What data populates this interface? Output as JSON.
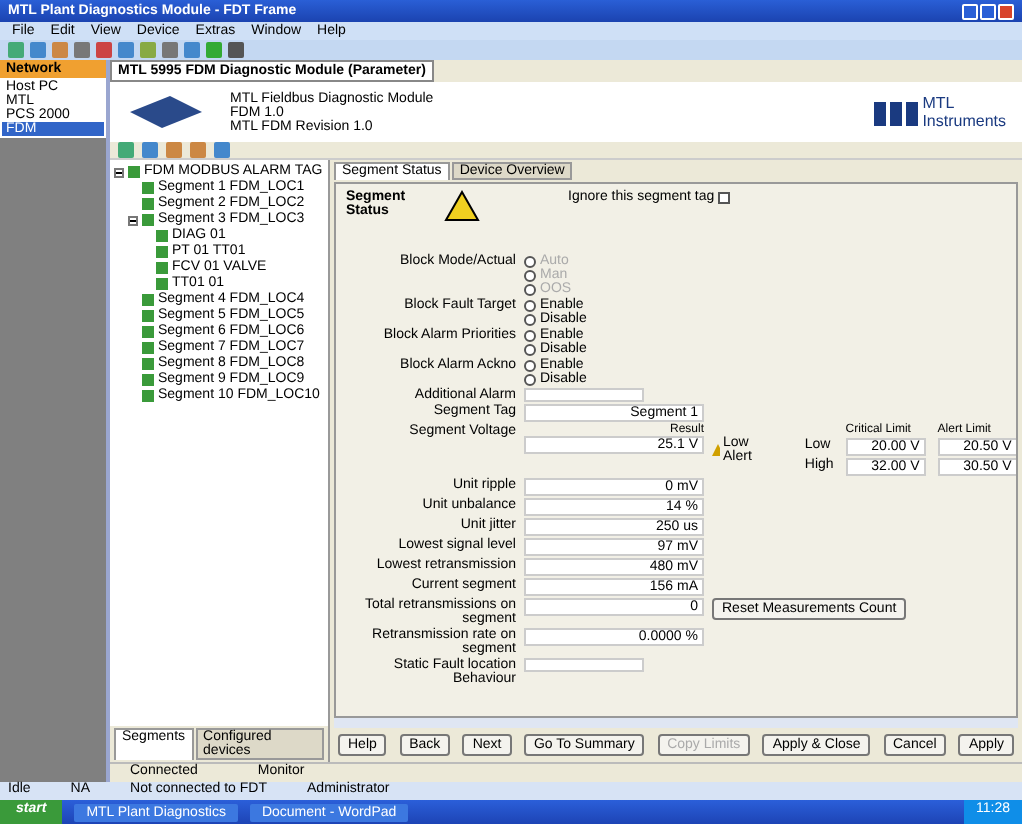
{
  "window": {
    "title": "MTL Plant Diagnostics Module - FDT Frame"
  },
  "menu": [
    "File",
    "Edit",
    "View",
    "Device",
    "Extras",
    "Window",
    "Help"
  ],
  "navigator": {
    "title": "Network",
    "items": [
      {
        "label": "Host PC",
        "selected": false
      },
      {
        "label": "MTL",
        "selected": false
      },
      {
        "label": "PCS 2000",
        "selected": false
      },
      {
        "label": "FDM",
        "selected": true
      }
    ]
  },
  "document_tab": {
    "label": "MTL 5995 FDM Diagnostic Module (Parameter)"
  },
  "device_header": {
    "lines": [
      "MTL Fieldbus Diagnostic Module",
      "FDM 1.0",
      "MTL FDM Revision 1.0"
    ],
    "brand": [
      "MTL",
      "Instruments"
    ]
  },
  "tree": {
    "label": "FDM MODBUS ALARM TAG",
    "expanded": true,
    "children": [
      {
        "label": "Segment 1 FDM_LOC1"
      },
      {
        "label": "Segment 2 FDM_LOC2"
      },
      {
        "label": "Segment 3 FDM_LOC3",
        "expanded": true,
        "children": [
          {
            "label": "DIAG 01"
          },
          {
            "label": "PT 01 TT01"
          },
          {
            "label": "FCV 01 VALVE"
          },
          {
            "label": "TT01 01"
          }
        ]
      },
      {
        "label": "Segment 4 FDM_LOC4"
      },
      {
        "label": "Segment 5 FDM_LOC5"
      },
      {
        "label": "Segment 6 FDM_LOC6"
      },
      {
        "label": "Segment 7 FDM_LOC7"
      },
      {
        "label": "Segment 8 FDM_LOC8"
      },
      {
        "label": "Segment 9 FDM_LOC9"
      },
      {
        "label": "Segment 10 FDM_LOC10"
      }
    ]
  },
  "tree_tabs": [
    {
      "label": "Segments",
      "selected": true
    },
    {
      "label": "Configured devices",
      "selected": false
    }
  ],
  "tabs": [
    {
      "label": "Segment Status",
      "selected": true
    },
    {
      "label": "Device Overview",
      "selected": false
    }
  ],
  "form": {
    "heading": "Segment Status",
    "ignore": {
      "label": "Ignore this segment tag",
      "checked": false
    },
    "groups": [
      {
        "label": "Block Mode/Actual",
        "options": [
          {
            "label": "Auto",
            "selected": false,
            "disabled": true
          },
          {
            "label": "Man",
            "selected": false,
            "disabled": true
          },
          {
            "label": "OOS",
            "selected": false,
            "disabled": true
          }
        ]
      },
      {
        "label": "Block Fault Target",
        "options": [
          {
            "label": "Enable",
            "selected": false,
            "disabled": false
          },
          {
            "label": "Disable",
            "selected": false,
            "disabled": false
          }
        ]
      },
      {
        "label": "Block Alarm Priorities",
        "options": [
          {
            "label": "Enable",
            "selected": false,
            "disabled": false
          },
          {
            "label": "Disable",
            "selected": false,
            "disabled": false
          }
        ]
      },
      {
        "label": "Block Alarm Ackno",
        "options": [
          {
            "label": "Enable",
            "selected": false,
            "disabled": false
          },
          {
            "label": "Disable",
            "selected": false,
            "disabled": false
          }
        ]
      }
    ],
    "additional": {
      "label": "Additional Alarm"
    },
    "tag": {
      "label": "Segment Tag",
      "value": "Segment 1"
    },
    "voltage": {
      "label": "Segment Voltage",
      "result_heading": "Result",
      "value": "25.1 V",
      "status": "Low Alert",
      "limits_columns": [
        "Critical Limit",
        "Alert Limit"
      ],
      "limits_rows": [
        {
          "label": "Low",
          "values": [
            "20.00 V",
            "20.50 V"
          ]
        },
        {
          "label": "High",
          "values": [
            "32.00 V",
            "30.50 V"
          ]
        }
      ]
    },
    "measurements": [
      {
        "label": "Unit ripple",
        "value": "0 mV"
      },
      {
        "label": "Unit unbalance",
        "value": "14 %"
      },
      {
        "label": "Unit jitter",
        "value": "250 us"
      },
      {
        "label": "Lowest signal level",
        "value": "97 mV"
      },
      {
        "label": "Lowest retransmission",
        "value": "480 mV"
      },
      {
        "label": "Current segment",
        "value": "156 mA"
      },
      {
        "label": "Total retransmissions on segment",
        "value": "0"
      },
      {
        "label": "Retransmission rate on segment",
        "value": "0.0000 %"
      }
    ],
    "reset_button": "Reset Measurements Count",
    "last_label": "Static Fault location Behaviour"
  },
  "buttons": [
    {
      "label": "Help",
      "disabled": false
    },
    {
      "label": "Back",
      "disabled": false
    },
    {
      "label": "Next",
      "disabled": false
    },
    {
      "label": "Go To Summary",
      "disabled": false
    },
    {
      "label": "Copy Limits",
      "disabled": true
    },
    {
      "label": "Apply & Close",
      "disabled": false
    },
    {
      "label": "Cancel",
      "disabled": false
    },
    {
      "label": "Apply",
      "disabled": false
    }
  ],
  "bottom_tabs": [
    "Connected",
    "Monitor"
  ],
  "status_bar": [
    "Idle",
    "NA",
    "Not connected to FDT",
    "Administrator"
  ],
  "taskbar": {
    "start": "start",
    "items": [
      "MTL Plant Diagnostics",
      "Document - WordPad"
    ],
    "clock": "11:28"
  }
}
